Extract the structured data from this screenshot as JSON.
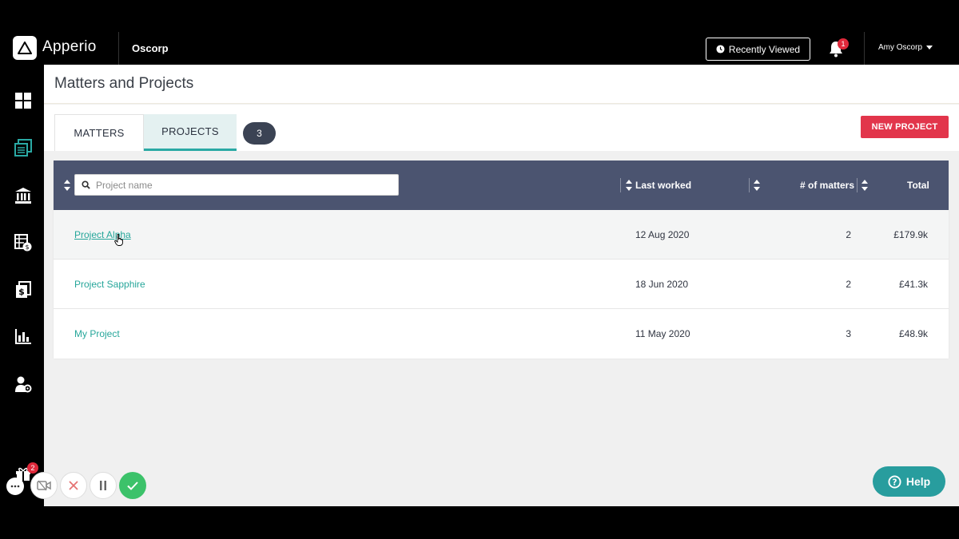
{
  "header": {
    "brand": "Apperio",
    "company": "Oscorp",
    "recently_viewed_label": "Recently Viewed",
    "notification_count": "1",
    "user_name": "Amy Oscorp"
  },
  "sidebar": {
    "items": [
      {
        "name": "dashboard",
        "icon": "grid-icon"
      },
      {
        "name": "matters",
        "icon": "documents-icon",
        "active": true
      },
      {
        "name": "firms",
        "icon": "bank-icon"
      },
      {
        "name": "budgets",
        "icon": "spreadsheet-money-icon"
      },
      {
        "name": "invoices",
        "icon": "invoice-icon"
      },
      {
        "name": "reports",
        "icon": "bar-chart-icon"
      },
      {
        "name": "admin",
        "icon": "user-settings-icon"
      }
    ],
    "gift_badge": "2"
  },
  "page": {
    "title": "Matters and Projects",
    "tabs": [
      {
        "label": "MATTERS",
        "active": false
      },
      {
        "label": "PROJECTS",
        "active": true
      }
    ],
    "count": "3",
    "new_project_label": "NEW PROJECT"
  },
  "table": {
    "search_placeholder": "Project name",
    "columns": {
      "last_worked": "Last worked",
      "matters": "# of matters",
      "total": "Total"
    },
    "rows": [
      {
        "name": "Project Alpha",
        "last_worked": "12 Aug 2020",
        "matters": "2",
        "total": "£179.9k"
      },
      {
        "name": "Project Sapphire",
        "last_worked": "18 Jun 2020",
        "matters": "2",
        "total": "£41.3k"
      },
      {
        "name": "My Project",
        "last_worked": "11 May 2020",
        "matters": "3",
        "total": "£48.9k"
      }
    ]
  },
  "help": {
    "label": "Help"
  },
  "colors": {
    "accent": "#2aa9a4",
    "danger": "#e2354b",
    "table_header": "#4b5470",
    "link": "#26a69a"
  }
}
